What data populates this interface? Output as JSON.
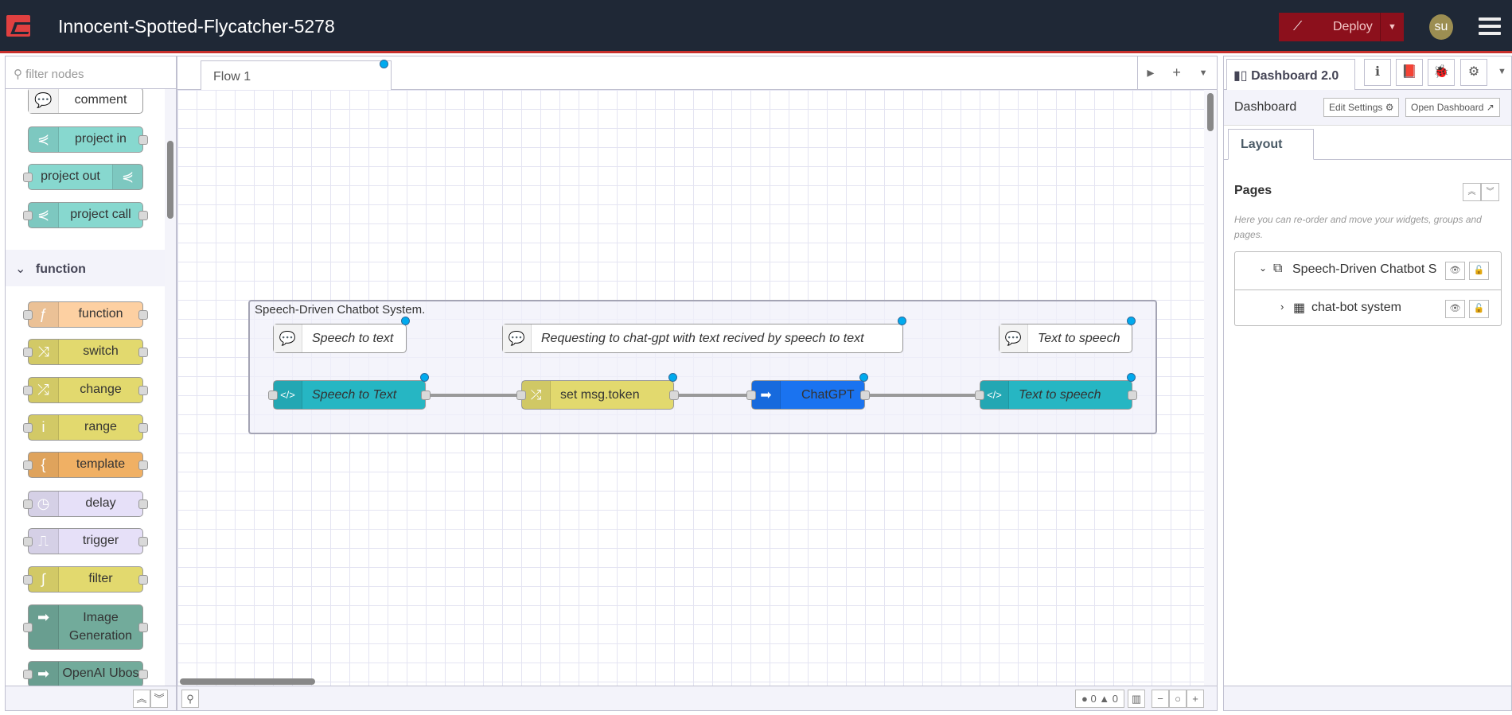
{
  "header": {
    "title": "Innocent-Spotted-Flycatcher-5278",
    "deploy_label": "Deploy",
    "avatar": "su",
    "colors": {
      "bar": "#1f2836",
      "deploy": "#8c101c",
      "accent": "#c8302c"
    }
  },
  "palette": {
    "search_placeholder": "filter nodes",
    "category": "function",
    "nodes": [
      {
        "label": "comment",
        "color": "#ffffff",
        "icon": "comment-icon",
        "glyph": "💬",
        "in": false,
        "out": false,
        "top": 0
      },
      {
        "label": "project in",
        "color": "#87d8cf",
        "icon": "project-icon",
        "glyph": "⋞",
        "in": false,
        "out": true
      },
      {
        "label": "project out",
        "color": "#87d8cf",
        "icon": "project-icon",
        "glyph": "⋞",
        "in": true,
        "out": false,
        "iconRight": true
      },
      {
        "label": "project call",
        "color": "#87d8cf",
        "icon": "project-icon",
        "glyph": "⋞",
        "in": true,
        "out": true
      },
      {
        "label": "function",
        "color": "#fdd0a2",
        "icon": "function-icon",
        "glyph": "ƒ",
        "in": true,
        "out": true
      },
      {
        "label": "switch",
        "color": "#e2d96e",
        "icon": "switch-icon",
        "glyph": "⤨",
        "in": true,
        "out": true
      },
      {
        "label": "change",
        "color": "#e2d96e",
        "icon": "shuffle-icon",
        "glyph": "⤮",
        "in": true,
        "out": true
      },
      {
        "label": "range",
        "color": "#e2d96e",
        "icon": "range-icon",
        "glyph": "i",
        "in": true,
        "out": true
      },
      {
        "label": "template",
        "color": "#f0b064",
        "icon": "template-icon",
        "glyph": "{",
        "in": true,
        "out": true
      },
      {
        "label": "delay",
        "color": "#e6e0f8",
        "icon": "timer-icon",
        "glyph": "◷",
        "in": true,
        "out": true
      },
      {
        "label": "trigger",
        "color": "#e6e0f8",
        "icon": "trigger-icon",
        "glyph": "⎍",
        "in": true,
        "out": true
      },
      {
        "label": "filter",
        "color": "#e2d96e",
        "icon": "filter-icon",
        "glyph": "∫",
        "in": true,
        "out": true
      },
      {
        "label": "Image Generation",
        "color": "#72ab9b",
        "icon": "arrow-icon",
        "glyph": "➡",
        "in": true,
        "out": true,
        "tall": true
      },
      {
        "label": "OpenAI Ubos",
        "color": "#72ab9b",
        "icon": "arrow-icon",
        "glyph": "➡",
        "in": true,
        "out": true
      }
    ]
  },
  "workspace": {
    "tab": "Flow 1",
    "group_label": "Speech-Driven Chatbot System.",
    "comments": [
      {
        "label": "Speech to text"
      },
      {
        "label": "Requesting to chat-gpt with text recived by speech to text"
      },
      {
        "label": "Text to speech"
      }
    ],
    "nodes": [
      {
        "label": "Speech to Text",
        "color": "#26b6c3",
        "icon": "code-icon",
        "glyph": "</>",
        "italic": true
      },
      {
        "label": "set msg.token",
        "color": "#e2d96e",
        "icon": "shuffle-icon",
        "glyph": "⤮",
        "italic": false
      },
      {
        "label": "ChatGPT",
        "color": "#1a73f0",
        "icon": "arrow-icon",
        "glyph": "➡",
        "italic": false
      },
      {
        "label": "Text to speech",
        "color": "#26b6c3",
        "icon": "code-icon",
        "glyph": "</>",
        "italic": true
      }
    ],
    "footer": {
      "errors": "0",
      "warnings": "0"
    }
  },
  "sidebar": {
    "tab": "Dashboard 2.0",
    "header": "Dashboard",
    "edit_settings": "Edit Settings",
    "open_dashboard": "Open Dashboard",
    "layout_tab": "Layout",
    "pages_title": "Pages",
    "pages_desc": "Here you can re-order and move your widgets, groups and pages.",
    "tree": [
      {
        "label": "Speech-Driven Chatbot S",
        "icon": "page-icon"
      },
      {
        "label": "chat-bot system",
        "icon": "table-icon"
      }
    ]
  }
}
